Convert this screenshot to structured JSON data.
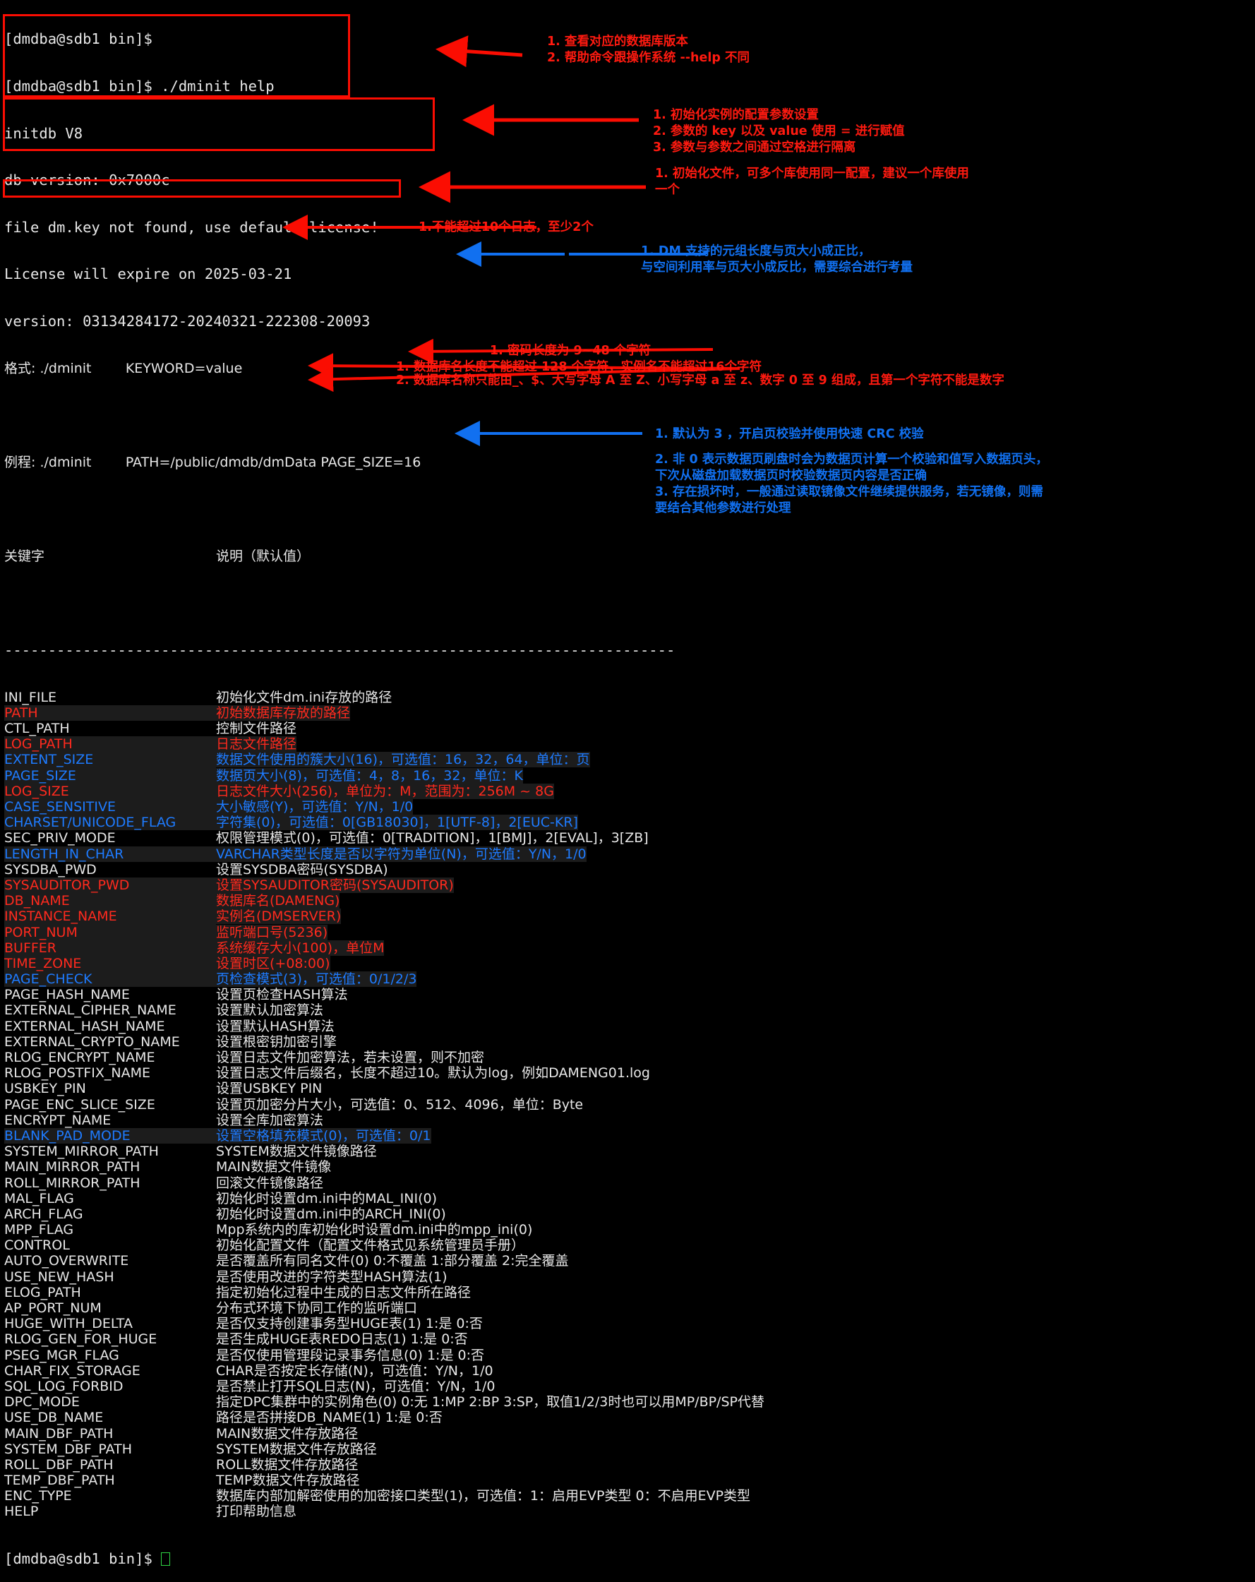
{
  "terminal": {
    "prompt": "[dmdba@sdb1 bin]$",
    "command_line": "[dmdba@sdb1 bin]$ ./dminit help",
    "header_lines": [
      "initdb V8",
      "db version: 0x7000c",
      "file dm.key not found, use default license!",
      "License will expire on 2025-03-21",
      "version: 03134284172-20240321-222308-20093"
    ],
    "format_line": "格式: ./dminit        KEYWORD=value",
    "example_line": "例程: ./dminit        PATH=/public/dmdb/dmData PAGE_SIZE=16",
    "col_header_keyword": "关键字",
    "col_header_desc": "说明（默认值）",
    "separator": "-----------------------------------------------------------------------------",
    "final_prompt": "[dmdba@sdb1 bin]$"
  },
  "rows": [
    {
      "kw": "INI_FILE",
      "desc": "初始化文件dm.ini存放的路径",
      "color": "white",
      "hl": false
    },
    {
      "kw": "PATH",
      "desc": "初始数据库存放的路径",
      "color": "red",
      "hl": true
    },
    {
      "kw": "CTL_PATH",
      "desc": "控制文件路径",
      "color": "white",
      "hl": false
    },
    {
      "kw": "LOG_PATH",
      "desc": "日志文件路径",
      "color": "red",
      "hl": true
    },
    {
      "kw": "EXTENT_SIZE",
      "desc": "数据文件使用的簇大小(16)，可选值：16，32，64，单位：页",
      "color": "blue",
      "hl": true
    },
    {
      "kw": "PAGE_SIZE",
      "desc": "数据页大小(8)，可选值：4，8，16，32，单位：K",
      "color": "blue",
      "hl": true
    },
    {
      "kw": "LOG_SIZE",
      "desc": "日志文件大小(256)，单位为：M，范围为：256M ~ 8G",
      "color": "red",
      "hl": true
    },
    {
      "kw": "CASE_SENSITIVE",
      "desc": "大小敏感(Y)，可选值：Y/N，1/0",
      "color": "blue",
      "hl": true
    },
    {
      "kw": "CHARSET/UNICODE_FLAG",
      "desc": "字符集(0)，可选值：0[GB18030]，1[UTF-8]，2[EUC-KR]",
      "color": "blue",
      "hl": true
    },
    {
      "kw": "SEC_PRIV_MODE",
      "desc": "权限管理模式(0)，可选值：0[TRADITION]，1[BMJ]，2[EVAL]，3[ZB]",
      "color": "white",
      "hl": false
    },
    {
      "kw": "LENGTH_IN_CHAR",
      "desc": "VARCHAR类型长度是否以字符为单位(N)，可选值：Y/N，1/0",
      "color": "blue",
      "hl": true
    },
    {
      "kw": "SYSDBA_PWD",
      "desc": "设置SYSDBA密码(SYSDBA)",
      "color": "white",
      "hl": false
    },
    {
      "kw": "SYSAUDITOR_PWD",
      "desc": "设置SYSAUDITOR密码(SYSAUDITOR)",
      "color": "red",
      "hl": true
    },
    {
      "kw": "DB_NAME",
      "desc": "数据库名(DAMENG)",
      "color": "red",
      "hl": true
    },
    {
      "kw": "INSTANCE_NAME",
      "desc": "实例名(DMSERVER)",
      "color": "red",
      "hl": true
    },
    {
      "kw": "PORT_NUM",
      "desc": "监听端口号(5236)",
      "color": "red",
      "hl": true
    },
    {
      "kw": "BUFFER",
      "desc": "系统缓存大小(100)，单位M",
      "color": "red",
      "hl": true
    },
    {
      "kw": "TIME_ZONE",
      "desc": "设置时区(+08:00)",
      "color": "red",
      "hl": true
    },
    {
      "kw": "PAGE_CHECK",
      "desc": "页检查模式(3)，可选值：0/1/2/3",
      "color": "blue",
      "hl": true
    },
    {
      "kw": "PAGE_HASH_NAME",
      "desc": "设置页检查HASH算法",
      "color": "white",
      "hl": false
    },
    {
      "kw": "EXTERNAL_CIPHER_NAME",
      "desc": "设置默认加密算法",
      "color": "white",
      "hl": false
    },
    {
      "kw": "EXTERNAL_HASH_NAME",
      "desc": "设置默认HASH算法",
      "color": "white",
      "hl": false
    },
    {
      "kw": "EXTERNAL_CRYPTO_NAME",
      "desc": "设置根密钥加密引擎",
      "color": "white",
      "hl": false
    },
    {
      "kw": "RLOG_ENCRYPT_NAME",
      "desc": "设置日志文件加密算法，若未设置，则不加密",
      "color": "white",
      "hl": false
    },
    {
      "kw": "RLOG_POSTFIX_NAME",
      "desc": "设置日志文件后缀名，长度不超过10。默认为log，例如DAMENG01.log",
      "color": "white",
      "hl": false
    },
    {
      "kw": "USBKEY_PIN",
      "desc": "设置USBKEY PIN",
      "color": "white",
      "hl": false
    },
    {
      "kw": "PAGE_ENC_SLICE_SIZE",
      "desc": "设置页加密分片大小，可选值：0、512、4096，单位：Byte",
      "color": "white",
      "hl": false
    },
    {
      "kw": "ENCRYPT_NAME",
      "desc": "设置全库加密算法",
      "color": "white",
      "hl": false
    },
    {
      "kw": "BLANK_PAD_MODE",
      "desc": "设置空格填充模式(0)，可选值：0/1",
      "color": "blue",
      "hl": true
    },
    {
      "kw": "SYSTEM_MIRROR_PATH",
      "desc": "SYSTEM数据文件镜像路径",
      "color": "white",
      "hl": false
    },
    {
      "kw": "MAIN_MIRROR_PATH",
      "desc": "MAIN数据文件镜像",
      "color": "white",
      "hl": false
    },
    {
      "kw": "ROLL_MIRROR_PATH",
      "desc": "回滚文件镜像路径",
      "color": "white",
      "hl": false
    },
    {
      "kw": "MAL_FLAG",
      "desc": "初始化时设置dm.ini中的MAL_INI(0)",
      "color": "white",
      "hl": false
    },
    {
      "kw": "ARCH_FLAG",
      "desc": "初始化时设置dm.ini中的ARCH_INI(0)",
      "color": "white",
      "hl": false
    },
    {
      "kw": "MPP_FLAG",
      "desc": "Mpp系统内的库初始化时设置dm.ini中的mpp_ini(0)",
      "color": "white",
      "hl": false
    },
    {
      "kw": "CONTROL",
      "desc": "初始化配置文件（配置文件格式见系统管理员手册）",
      "color": "white",
      "hl": false
    },
    {
      "kw": "AUTO_OVERWRITE",
      "desc": "是否覆盖所有同名文件(0) 0:不覆盖 1:部分覆盖 2:完全覆盖",
      "color": "white",
      "hl": false
    },
    {
      "kw": "USE_NEW_HASH",
      "desc": "是否使用改进的字符类型HASH算法(1)",
      "color": "white",
      "hl": false
    },
    {
      "kw": "ELOG_PATH",
      "desc": "指定初始化过程中生成的日志文件所在路径",
      "color": "white",
      "hl": false
    },
    {
      "kw": "AP_PORT_NUM",
      "desc": "分布式环境下协同工作的监听端口",
      "color": "white",
      "hl": false
    },
    {
      "kw": "HUGE_WITH_DELTA",
      "desc": "是否仅支持创建事务型HUGE表(1) 1:是 0:否",
      "color": "white",
      "hl": false
    },
    {
      "kw": "RLOG_GEN_FOR_HUGE",
      "desc": "是否生成HUGE表REDO日志(1) 1:是 0:否",
      "color": "white",
      "hl": false
    },
    {
      "kw": "PSEG_MGR_FLAG",
      "desc": "是否仅使用管理段记录事务信息(0) 1:是 0:否",
      "color": "white",
      "hl": false
    },
    {
      "kw": "CHAR_FIX_STORAGE",
      "desc": "CHAR是否按定长存储(N)，可选值：Y/N，1/0",
      "color": "white",
      "hl": false
    },
    {
      "kw": "SQL_LOG_FORBID",
      "desc": "是否禁止打开SQL日志(N)，可选值：Y/N，1/0",
      "color": "white",
      "hl": false
    },
    {
      "kw": "DPC_MODE",
      "desc": "指定DPC集群中的实例角色(0) 0:无 1:MP 2:BP 3:SP，取值1/2/3时也可以用MP/BP/SP代替",
      "color": "white",
      "hl": false
    },
    {
      "kw": "USE_DB_NAME",
      "desc": "路径是否拼接DB_NAME(1) 1:是 0:否",
      "color": "white",
      "hl": false
    },
    {
      "kw": "MAIN_DBF_PATH",
      "desc": "MAIN数据文件存放路径",
      "color": "white",
      "hl": false
    },
    {
      "kw": "SYSTEM_DBF_PATH",
      "desc": "SYSTEM数据文件存放路径",
      "color": "white",
      "hl": false
    },
    {
      "kw": "ROLL_DBF_PATH",
      "desc": "ROLL数据文件存放路径",
      "color": "white",
      "hl": false
    },
    {
      "kw": "TEMP_DBF_PATH",
      "desc": "TEMP数据文件存放路径",
      "color": "white",
      "hl": false
    },
    {
      "kw": "ENC_TYPE",
      "desc": "数据库内部加解密使用的加密接口类型(1)，可选值：1：启用EVP类型 0：不启用EVP类型",
      "color": "white",
      "hl": false
    },
    {
      "kw": "HELP",
      "desc": "打印帮助信息",
      "color": "white",
      "hl": false
    }
  ],
  "annotations": {
    "a1": "1. 查看对应的数据库版本\n2. 帮助命令跟操作系统 --help 不同",
    "a2": "1. 初始化实例的配置参数设置\n2. 参数的 key 以及 value 使用 = 进行赋值\n3. 参数与参数之间通过空格进行隔离",
    "a3": "1. 初始化文件，可多个库使用同一配置，建议一个库使用\n一个",
    "a4": "1.不能超过10个日志，至少2个",
    "a5": "1. DM 支持的元组长度与页大小成正比，\n与空间利用率与页大小成反比，需要综合进行考量",
    "a6": "1. 密码长度为 9~48 个字符",
    "a7": "1. 数据库名长度不能超过 128 个字符，实例名不能超过16个字符",
    "a8": "2. 数据库名称只能由_、$、大写字母 A 至 Z、小写字母 a 至 z、数字 0 至 9 组成，且第一个字符不能是数字",
    "a9": "1. 默认为 3 ，开启页校验并使用快速 CRC 校验",
    "a10": "2. 非 0 表示数据页刷盘时会为数据页计算一个校验和值写入数据页头，\n下次从磁盘加载数据页时校验数据页内容是否正确",
    "a11": "3. 存在损坏时，一般通过读取镜像文件继续提供服务，若无镜像，则需\n要结合其他参数进行处理"
  },
  "colors": {
    "background": "#000000",
    "terminal_text": "#e6e6e6",
    "annotation_red": "#ff1a10",
    "annotation_blue": "#1170f0",
    "box_red": "#fb0d02",
    "cursor_green": "#2fd644",
    "highlight": "#1c1c1c"
  }
}
